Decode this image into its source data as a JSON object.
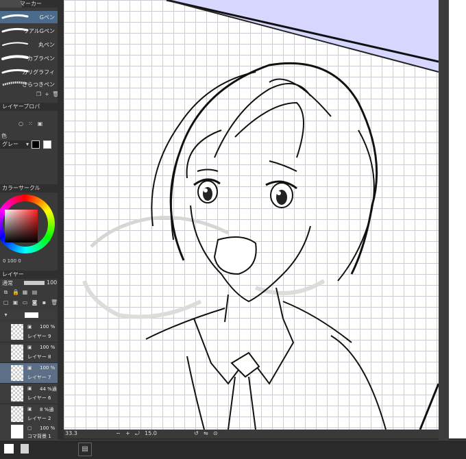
{
  "toolbar": {
    "tab_label": "マーカー"
  },
  "brushes": [
    {
      "label": "Gペン",
      "selected": true
    },
    {
      "label": "リアルGペン",
      "selected": false
    },
    {
      "label": "丸ペン",
      "selected": false
    },
    {
      "label": "カブラペン",
      "selected": false
    },
    {
      "label": "カリグラフィ",
      "selected": false
    },
    {
      "label": "さらつきペン",
      "selected": false
    }
  ],
  "property": {
    "tab_label": "レイヤープロパ",
    "color_label": "色",
    "color_value": "グレー"
  },
  "color_circle": {
    "tab_label": "カラーサークル",
    "readout": "0  100  0"
  },
  "layers_panel": {
    "tab_label": "レイヤー",
    "blend_mode": "通常",
    "opacity": "100"
  },
  "layers": [
    {
      "opacity": "100 %",
      "name": "レイヤー 9",
      "selected": false
    },
    {
      "opacity": "100 %",
      "name": "レイヤー 8",
      "selected": false
    },
    {
      "opacity": "100 %",
      "name": "レイヤー 7",
      "selected": true
    },
    {
      "opacity": "44 %通",
      "name": "レイヤー 6",
      "selected": false
    },
    {
      "opacity": "8 %通",
      "name": "レイヤー 2",
      "selected": false
    },
    {
      "opacity": "100 %",
      "name": "コマ背景 1",
      "selected": false
    }
  ],
  "canvas_status": {
    "zoom": "33.3",
    "rotation": "15.0"
  }
}
